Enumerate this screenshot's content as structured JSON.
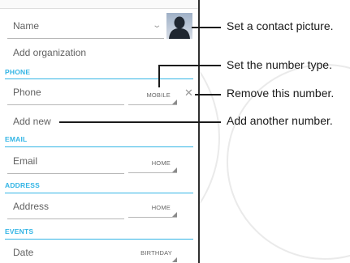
{
  "contact_form": {
    "name_placeholder": "Name",
    "add_organization": "Add organization",
    "phone": {
      "section_title": "PHONE",
      "placeholder": "Phone",
      "type": "MOBILE"
    },
    "add_new": "Add new",
    "email": {
      "section_title": "EMAIL",
      "placeholder": "Email",
      "type": "HOME"
    },
    "address": {
      "section_title": "ADDRESS",
      "placeholder": "Address",
      "type": "HOME"
    },
    "events": {
      "section_title": "EVENTS",
      "placeholder": "Date",
      "type": "BIRTHDAY"
    }
  },
  "callouts": {
    "picture": "Set a contact picture.",
    "number_type": "Set the number type.",
    "remove_number": "Remove this number.",
    "add_number": "Add another number."
  },
  "icons": {
    "avatar": "contact-avatar-icon",
    "expand": "chevron-down-icon",
    "remove": "close-icon"
  },
  "colors": {
    "section_accent": "#33b5e5",
    "callout": "#1a1a1a"
  }
}
